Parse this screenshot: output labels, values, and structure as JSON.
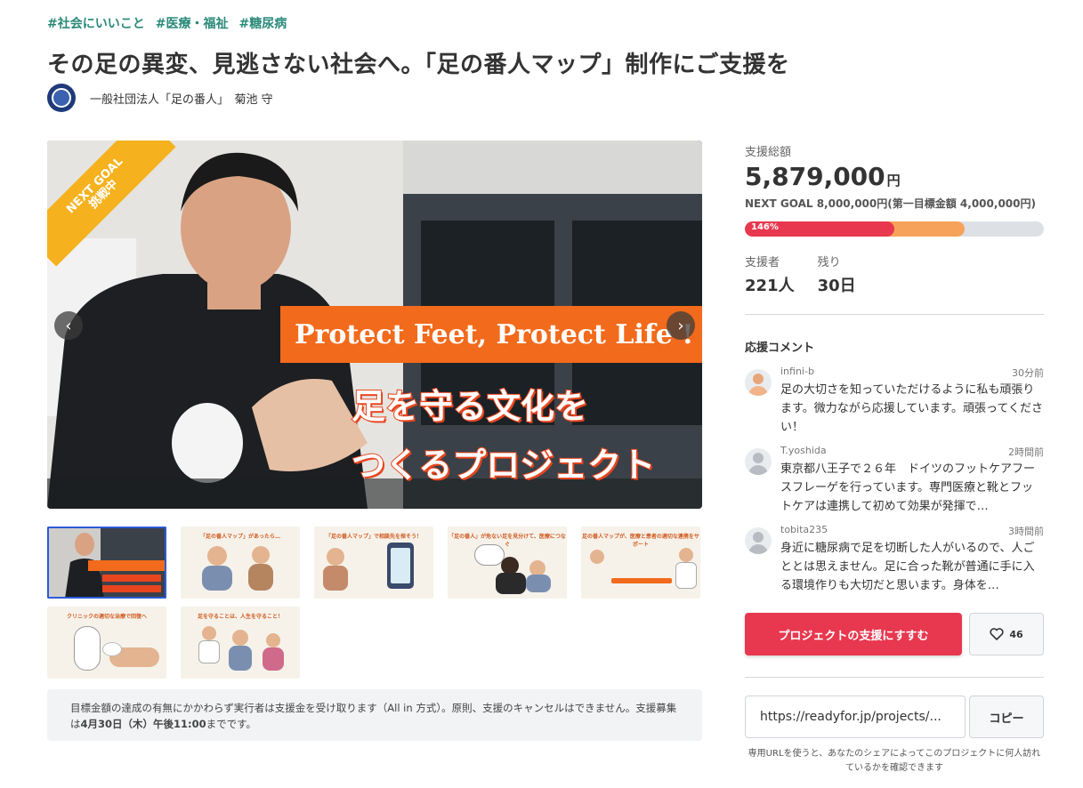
{
  "tags": [
    "#社会にいいこと",
    "#医療・福祉",
    "#糖尿病"
  ],
  "title": "その足の異変、見逃さない社会へ。「足の番人マップ」制作にご支援を",
  "owner": {
    "name": "一般社団法人「足の番人」　菊池 守"
  },
  "hero": {
    "ribbon_line1": "NEXT GOAL",
    "ribbon_line2": "挑戦中",
    "banner": "Protect Feet, Protect Life !",
    "jp_line1": "足を守る文化を",
    "jp_line2": "つくるプロジェクト",
    "prev_icon": "chevron-left-icon",
    "next_icon": "chevron-right-icon"
  },
  "thumbnails": [
    {
      "caption": ""
    },
    {
      "caption": "「足の番人マップ」があったら…"
    },
    {
      "caption": "「足の番人マップ」で相談先を探そう！"
    },
    {
      "caption": "「足の番人」が危ない足を見分けて、医療につなぐ"
    },
    {
      "caption": "足の番人マップが、医療と患者の適切な連携をサポート"
    },
    {
      "caption": "クリニックの適切な治療で回復へ"
    },
    {
      "caption": "足を守ることは、人生を守ること！"
    }
  ],
  "notice": {
    "text1": "目標金額の達成の有無にかかわらず実行者は支援金を受け取ります（All in 方式）。原則、支援のキャンセルはできません。支援募集は",
    "bold": "4月30日（木）午後11:00",
    "text2": "までです。"
  },
  "funding": {
    "total_label": "支援総額",
    "total": "5,879,000",
    "currency": "円",
    "goal_text": "NEXT GOAL 8,000,000円(第一目標金額 4,000,000円)",
    "percent_label": "146%",
    "first_goal_ratio": 0.5,
    "progress_ratio": 0.7349,
    "backers_label": "支援者",
    "backers": "221人",
    "remaining_label": "残り",
    "remaining": "30日"
  },
  "comments": {
    "title": "応援コメント",
    "items": [
      {
        "user": "infini-b",
        "time": "30分前",
        "avatar": "user-photo",
        "body": "足の大切さを知っていただけるように私も頑張ります。微力ながら応援しています。頑張ってください！"
      },
      {
        "user": "T.yoshida",
        "time": "2時間前",
        "avatar": "default-user",
        "body": "東京都八王子で２６年　ドイツのフットケアフースフレーゲを行っています。専門医療と靴とフットケアは連携して初めて効果が発揮で…"
      },
      {
        "user": "tobita235",
        "time": "3時間前",
        "avatar": "default-user",
        "body": "身近に糖尿病で足を切断した人がいるので、人ごととは思えません。足に合った靴が普通に手に入る環境作りも大切だと思います。身体を…"
      }
    ]
  },
  "actions": {
    "support_label": "プロジェクトの支援にすすむ",
    "favorite_count": "46",
    "favorite_icon": "heart-icon",
    "url": "https://readyfor.jp/projects/...",
    "copy_label": "コピー",
    "url_note": "専用URLを使うと、あなたのシェアによってこのプロジェクトに何人訪れているかを確認できます"
  }
}
